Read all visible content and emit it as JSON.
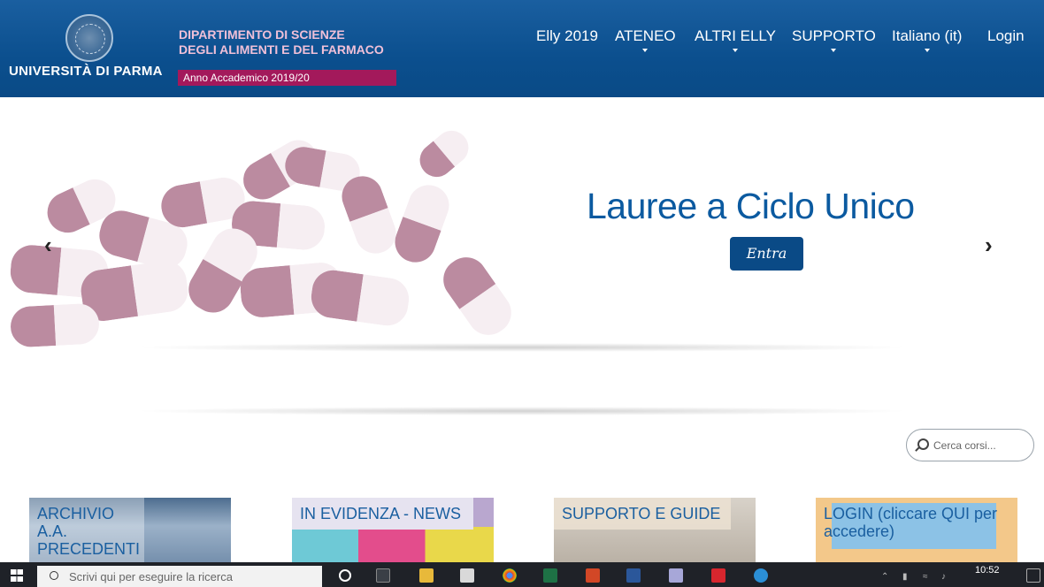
{
  "header": {
    "university_name": "UNIVERSITÀ DI PARMA",
    "department_line1": "DIPARTIMENTO DI SCIENZE",
    "department_line2": "DEGLI ALIMENTI E DEL FARMACO",
    "academic_year": "Anno Accademico 2019/20"
  },
  "nav": {
    "items": [
      {
        "label": "Elly 2019",
        "dropdown": false
      },
      {
        "label": "ATENEO",
        "dropdown": true
      },
      {
        "label": "ALTRI ELLY",
        "dropdown": true
      },
      {
        "label": "SUPPORTO",
        "dropdown": true
      },
      {
        "label": "Italiano (it)",
        "dropdown": true
      },
      {
        "label": "Login",
        "dropdown": false
      }
    ]
  },
  "carousel": {
    "title": "Lauree a Ciclo Unico",
    "button_label": "Entra",
    "prev_icon": "chevron-left-icon",
    "next_icon": "chevron-right-icon"
  },
  "search": {
    "placeholder": "Cerca corsi..."
  },
  "tiles": [
    {
      "label_line1": "ARCHIVIO A.A.",
      "label_line2": "PRECEDENTI"
    },
    {
      "label_line1": "IN EVIDENZA - NEWS"
    },
    {
      "label_line1": "SUPPORTO E GUIDE"
    },
    {
      "label_line1": "LOGIN (cliccare QUI per",
      "label_line2": "accedere)"
    }
  ],
  "taskbar": {
    "search_placeholder": "Scrivi qui per eseguire la ricerca",
    "time": "10:52"
  },
  "colors": {
    "header_blue": "#0b4f8e",
    "accent_magenta": "#a3195b",
    "title_blue": "#0b5aa0",
    "button_blue": "#0a4a86"
  }
}
